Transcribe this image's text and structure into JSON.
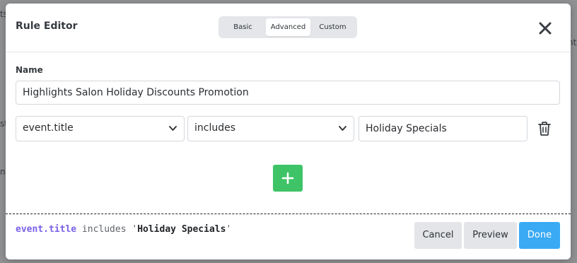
{
  "modal": {
    "title": "Rule Editor",
    "tabs": [
      {
        "label": "Basic",
        "active": false
      },
      {
        "label": "Advanced",
        "active": true
      },
      {
        "label": "Custom",
        "active": false
      }
    ]
  },
  "form": {
    "name_label": "Name",
    "name_value": "Highlights Salon Holiday Discounts Promotion",
    "condition": {
      "field": "event.title",
      "operator": "includes",
      "value": "Holiday Specials"
    }
  },
  "expression": {
    "field": "event.title",
    "operator": "includes",
    "value": "Holiday Specials"
  },
  "footer": {
    "cancel_label": "Cancel",
    "preview_label": "Preview",
    "done_label": "Done"
  },
  "backdrop": {
    "fragments": [
      "ts",
      "nt",
      "st",
      "ne"
    ]
  },
  "colors": {
    "accent": "#3aaaf5",
    "add_button": "#3ec467",
    "expression_field": "#7b61e8"
  },
  "icons": {
    "close": "close-icon",
    "chevron": "chevron-down-icon",
    "trash": "trash-icon",
    "add": "plus-icon"
  }
}
